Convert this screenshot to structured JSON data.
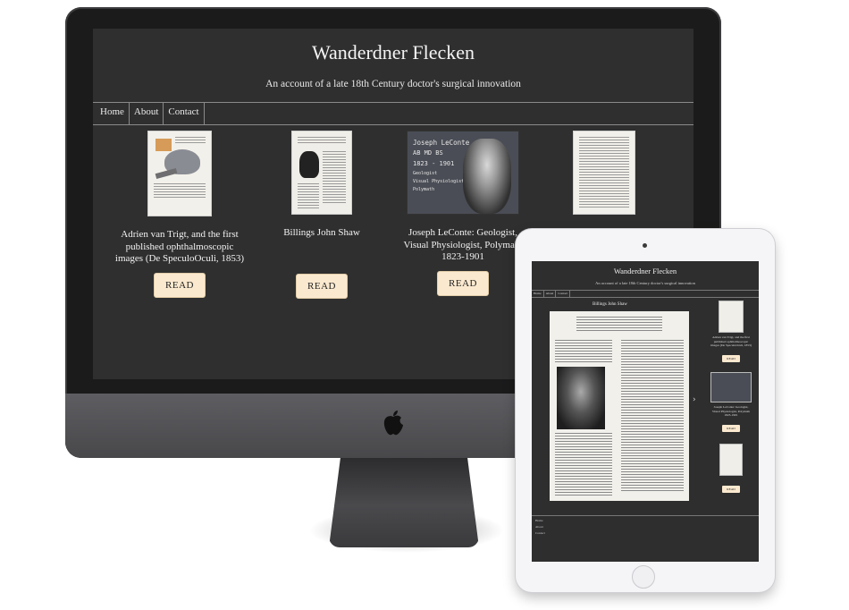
{
  "site": {
    "title": "Wanderdner Flecken",
    "subtitle": "An account of a late 18th Century doctor's surgical innovation"
  },
  "nav": [
    "Home",
    "About",
    "Contact"
  ],
  "cards": [
    {
      "title": "Adrien van Trigt, and the first published ophthalmoscopic images (De SpeculoOculi, 1853)",
      "button": "READ"
    },
    {
      "title": "Billings John Shaw",
      "button": "READ"
    },
    {
      "title": "Joseph LeConte: Geologist, Visual Physiologist, Polymath 1823-1901",
      "button": "READ"
    },
    {
      "title": "",
      "button": ""
    }
  ],
  "lecomte_thumb": [
    "Joseph LeConte",
    "AB MD BS",
    "1823 - 1901",
    "Geologist",
    "Visual Physiologist",
    "Polymath"
  ],
  "tablet": {
    "title": "Wanderdner Flecken",
    "subtitle": "An account of a late 18th Century doctor's surgical innovation",
    "nav": [
      "Home",
      "About",
      "Contact"
    ],
    "article_heading": "Billings John Shaw",
    "sidebar": [
      {
        "title": "Adrien van Trigt, and the first published ophthalmoscopic images (De SpeculoOculi, 1853)",
        "button": "READ"
      },
      {
        "title": "Joseph LeConte: Geologist, Visual Physiologist, Polymath 1823-1901",
        "button": "READ"
      },
      {
        "title": "",
        "button": "READ"
      }
    ],
    "footer_items": [
      "Home",
      "About",
      "Contact"
    ]
  }
}
